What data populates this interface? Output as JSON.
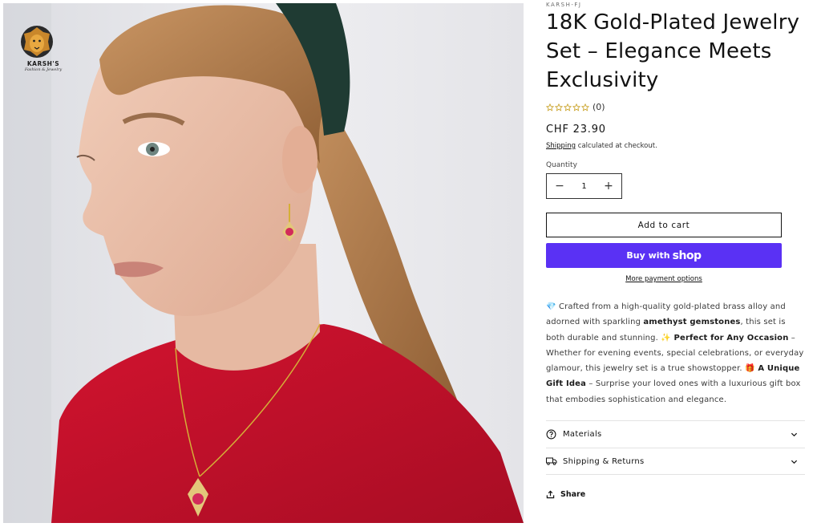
{
  "brand": {
    "logo_name": "KARSH'S",
    "logo_tagline": "Fashion & Jewelry"
  },
  "product": {
    "vendor": "KARSH-FJ",
    "title": "18K Gold-Plated Jewelry Set – Elegance Meets Exclusivity",
    "rating_count": "(0)",
    "price": "CHF 23.90",
    "shipping_link": "Shipping",
    "shipping_note": " calculated at checkout."
  },
  "quantity": {
    "label": "Quantity",
    "value": "1",
    "decrease": "−",
    "increase": "+"
  },
  "buttons": {
    "add_to_cart": "Add to cart",
    "buy_with": "Buy with",
    "buy_with_brand": "shop",
    "more_payment": "More payment options"
  },
  "description": {
    "p1_emoji": "💎",
    "p1_a": " Crafted from a high-quality gold-plated brass alloy and adorned with sparkling ",
    "p1_bold": "amethyst gemstones",
    "p1_b": ", this set is both durable and stunning. ",
    "p2_emoji": "✨",
    "p2_bold": " Perfect for Any Occasion",
    "p2_a": " – Whether for evening events, special celebrations, or everyday glamour, this jewelry set is a true showstopper. ",
    "p3_emoji": "🎁",
    "p3_bold": " A Unique Gift Idea",
    "p3_a": " – Surprise your loved ones with a luxurious gift box that embodies sophistication and elegance."
  },
  "accordions": [
    {
      "label": "Materials",
      "icon": "question-circle-icon"
    },
    {
      "label": "Shipping & Returns",
      "icon": "truck-icon"
    }
  ],
  "share": {
    "label": "Share",
    "icon": "share-icon"
  },
  "colors": {
    "shop_pay": "#5a31f4",
    "shirt": "#c8102e",
    "hair": "#b07a45",
    "headband": "#1f3b33",
    "star_outline": "#c9a227"
  }
}
